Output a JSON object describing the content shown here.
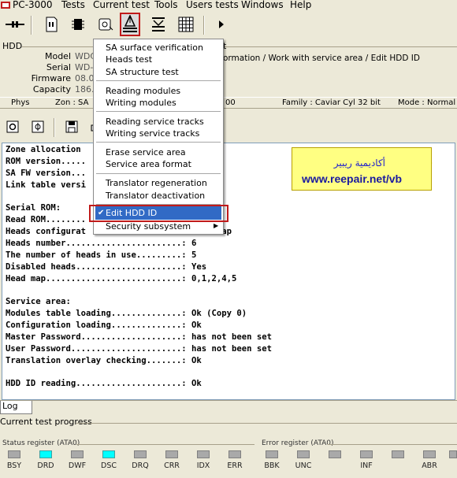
{
  "menubar": {
    "items": [
      "PC-3000",
      "Tests",
      "Current test",
      "Tools",
      "Users tests",
      "Windows",
      "Help"
    ]
  },
  "hdd": {
    "section_title": "HDD",
    "model_label": "Model",
    "model_value": "WDC",
    "serial_label": "Serial",
    "serial_value": "WD-",
    "firmware_label": "Firmware",
    "firmware_value": "08.0",
    "capacity_label": "Capacity",
    "capacity_value": "186.",
    "path_title": "t",
    "path": "ormation / Work with service area / Edit HDD ID"
  },
  "physbar": {
    "phys": "Phys",
    "zon": "Zon : SA",
    "code": "00",
    "family": "Family : Caviar Cyl 32 bit",
    "mode": "Mode : Normal"
  },
  "context_menu": {
    "items": [
      {
        "label": "SA surface verification",
        "icon": "none"
      },
      {
        "label": "Heads test",
        "icon": "none"
      },
      {
        "label": "SA structure test",
        "icon": "none"
      },
      {
        "label": "Reading modules",
        "icon": "none"
      },
      {
        "label": "Writing modules",
        "icon": "none"
      },
      {
        "label": "Reading service tracks",
        "icon": "none"
      },
      {
        "label": "Writing service tracks",
        "icon": "none"
      },
      {
        "label": "Erase service area",
        "icon": "none"
      },
      {
        "label": "Service area format",
        "icon": "none"
      },
      {
        "label": "Translator regeneration",
        "icon": "none"
      },
      {
        "label": "Translator deactivation",
        "icon": "none"
      },
      {
        "label": "Edit HDD ID",
        "icon": "check-icon",
        "selected": true
      },
      {
        "label": "Security subsystem",
        "icon": "submenu-arrow-icon"
      }
    ]
  },
  "log": {
    "lines": [
      "Zone allocation                    : Ok",
      "ROM version.....                   : 21.CW.",
      "SA FW version...                   : 21.CWJ",
      "Link table versi                   : 02.GA.",
      "",
      "Serial ROM:",
      "Read ROM........                   : Ok",
      "Heads configurat                   : From map",
      "Heads number.......................: 6",
      "The number of heads in use.........: 5",
      "Disabled heads.....................: Yes",
      "Head map...........................: 0,1,2,4,5",
      "",
      "Service area:",
      "Modules table loading..............: Ok (Copy 0)",
      "Configuration loading..............: Ok",
      "Master Password....................: has not been set",
      "User Password......................: has not been set",
      "Translation overlay checking.......: Ok",
      "",
      "HDD ID reading.....................: Ok"
    ]
  },
  "callout": {
    "arabic": "أكاديمية ريبير",
    "url": "www.reepair.net/vb"
  },
  "bottom": {
    "log_tab": "Log",
    "progress_label": "Current test progress",
    "status_register_title": "Status register (ATA0)",
    "error_register_title": "Error register (ATA0)",
    "status_bits": [
      {
        "label": "BSY",
        "on": false
      },
      {
        "label": "DRD",
        "on": true
      },
      {
        "label": "DWF",
        "on": false
      },
      {
        "label": "DSC",
        "on": true
      },
      {
        "label": "DRQ",
        "on": false
      },
      {
        "label": "CRR",
        "on": false
      },
      {
        "label": "IDX",
        "on": false
      },
      {
        "label": "ERR",
        "on": false
      }
    ],
    "error_bits": [
      {
        "label": "BBK",
        "on": false
      },
      {
        "label": "UNC",
        "on": false
      },
      {
        "label": "",
        "on": false
      },
      {
        "label": "INF",
        "on": false
      },
      {
        "label": "",
        "on": false
      },
      {
        "label": "ABR",
        "on": false
      },
      {
        "label": "",
        "on": false
      }
    ]
  },
  "colors": {
    "highlight": "#316ac5",
    "indicator_on": "#00ffff",
    "indicator_off": "#a9a9a9",
    "annotation_red": "#c01a1a",
    "callout_bg": "#ffff82"
  }
}
